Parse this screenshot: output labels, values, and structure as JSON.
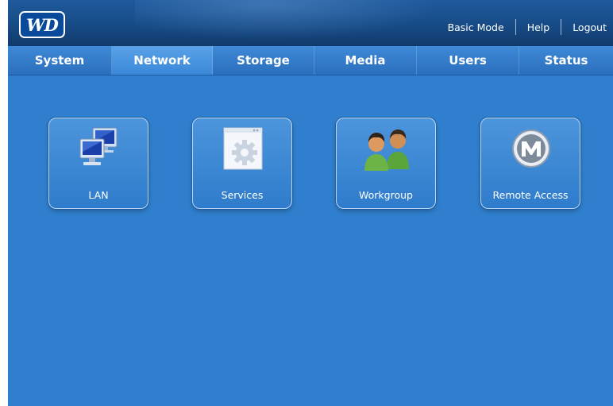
{
  "header": {
    "logo_text": "WD",
    "links": [
      "Basic Mode",
      "Help",
      "Logout"
    ]
  },
  "nav": {
    "tabs": [
      "System",
      "Network",
      "Storage",
      "Media",
      "Users",
      "Status"
    ],
    "active": "Network"
  },
  "tiles": [
    {
      "label": "LAN",
      "icon": "computers-icon"
    },
    {
      "label": "Services",
      "icon": "gear-icon"
    },
    {
      "label": "Workgroup",
      "icon": "users-icon"
    },
    {
      "label": "Remote Access",
      "icon": "remote-access-m-icon"
    }
  ],
  "colors": {
    "background": "#2f7fce",
    "header": "#174b86",
    "tab_bar": "#2f76c6",
    "active_tab": "#4a97e0",
    "text": "#ffffff"
  }
}
